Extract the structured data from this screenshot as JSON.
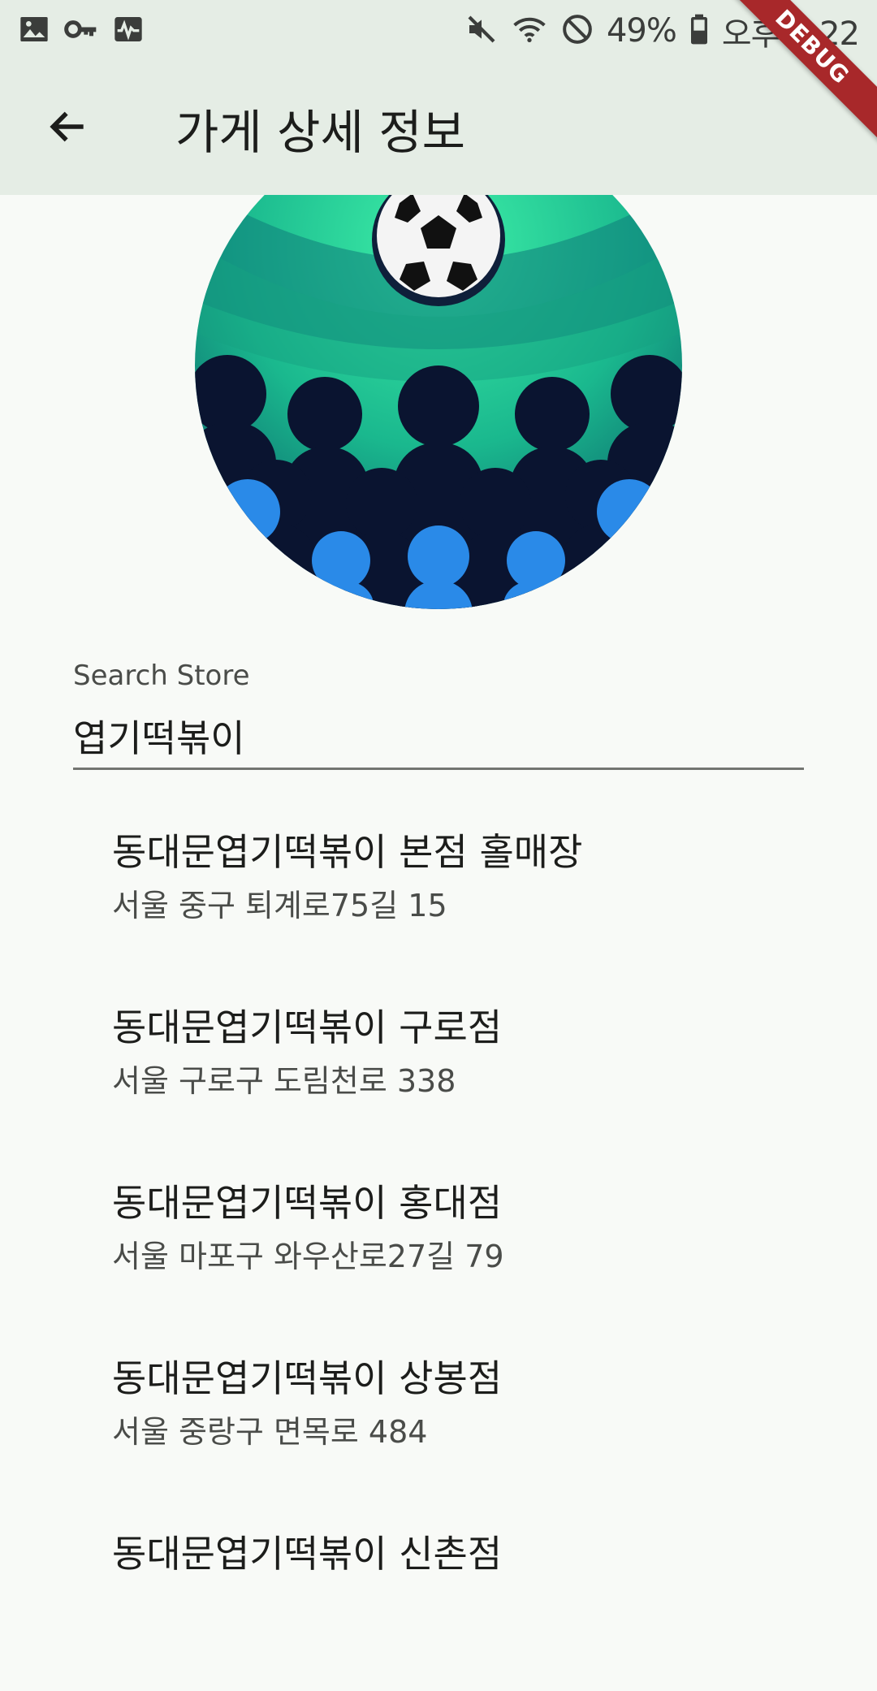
{
  "status_bar": {
    "battery": "49%",
    "time": "오후 9:22",
    "icons": [
      "image-icon",
      "key-icon",
      "activity-icon",
      "mute-icon",
      "wifi-icon",
      "do-not-disturb-icon",
      "battery-icon"
    ]
  },
  "debug_banner": "DEBUG",
  "app_bar": {
    "title": "가게 상세 정보",
    "back_icon": "arrow-back-icon"
  },
  "avatar": {
    "icon": "soccer-crowd-illustration"
  },
  "search": {
    "label": "Search Store",
    "value": "엽기떡볶이"
  },
  "results": [
    {
      "name": "동대문엽기떡볶이 본점 홀매장",
      "address": "서울 중구 퇴계로75길 15"
    },
    {
      "name": "동대문엽기떡볶이 구로점",
      "address": "서울 구로구 도림천로 338"
    },
    {
      "name": "동대문엽기떡볶이 홍대점",
      "address": "서울 마포구 와우산로27길 79"
    },
    {
      "name": "동대문엽기떡볶이 상봉점",
      "address": "서울 중랑구 면목로 484"
    },
    {
      "name": "동대문엽기떡볶이 신촌점",
      "address": ""
    }
  ],
  "colors": {
    "app_bar": "#e5ede5",
    "background": "#f8faf7",
    "debug": "#a8282a"
  }
}
